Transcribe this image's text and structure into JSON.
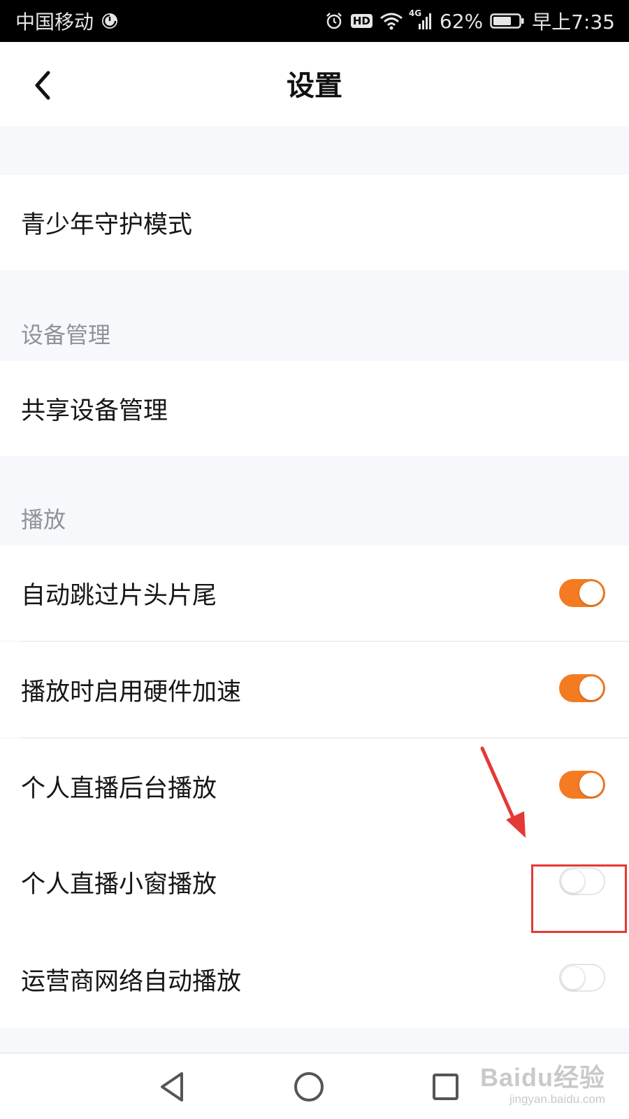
{
  "status_bar": {
    "carrier": "中国移动",
    "hd": "HD",
    "network": "4G",
    "battery": "62%",
    "time": "早上7:35",
    "icons": [
      "carrier-sync-icon",
      "alarm-icon",
      "hd-icon",
      "wifi-icon",
      "signal-icon",
      "battery-icon"
    ]
  },
  "header": {
    "title": "设置",
    "back_icon": "chevron-left-icon"
  },
  "rows": {
    "youth_mode": "青少年守护模式",
    "device_section": "设备管理",
    "shared_devices": "共享设备管理",
    "playback_section": "播放",
    "skip_intro_outro": {
      "label": "自动跳过片头片尾",
      "enabled": true
    },
    "hw_accel": {
      "label": "播放时启用硬件加速",
      "enabled": true
    },
    "live_background": {
      "label": "个人直播后台播放",
      "enabled": true
    },
    "live_pip": {
      "label": "个人直播小窗播放",
      "enabled": false
    },
    "cellular_autoplay": {
      "label": "运营商网络自动播放",
      "enabled": false
    }
  },
  "colors": {
    "toggle_on": "#f47b21",
    "annotation": "#e53935"
  },
  "nav_bar": {
    "icons": [
      "back-triangle-icon",
      "home-circle-icon",
      "recents-square-icon"
    ]
  },
  "watermark": {
    "main": "Baidu经验",
    "sub": "jingyan.baidu.com"
  }
}
